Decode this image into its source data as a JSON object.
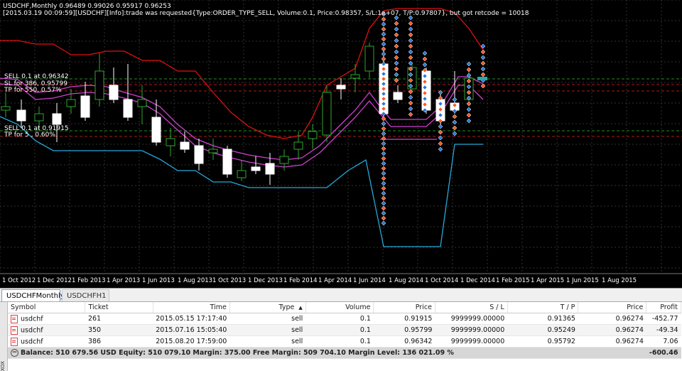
{
  "chart": {
    "title": "USDCHF,Monthly  0.96489 0.99026 0.95917 0.96253",
    "log_line": "[2015.03.19 00:09:59][USDCHF][Info]:trade was requested{Type:ORDER_TYPE_SELL, Volume:0.1, Price:0.98357, S/L:1e+07, T/P:0.97807}, but got retcode = 10018",
    "labels": {
      "sell1": "SELL 0.1 at 0.96342",
      "sl1": "SL for 386, 0.95799",
      "tp1": "TP for 550, 0.57%",
      "sell2": "SELL 0.1 at 0.91915",
      "tp2": "TP for 5 , 0.60%"
    },
    "x_ticks": [
      "1 Oct 2012",
      "1 Dec 2012",
      "1 Feb 2013",
      "1 Apr 2013",
      "1 Jun 2013",
      "1 Aug 2013",
      "1 Oct 2013",
      "1 Dec 2013",
      "1 Feb 2014",
      "1 Apr 2014",
      "1 Jun 2014",
      "1 Aug 2014",
      "1 Oct 2014",
      "1 Dec 2014",
      "1 Feb 2015",
      "1 Apr 2015",
      "1 Jun 2015",
      "1 Aug 2015"
    ],
    "colors": {
      "background": "#000000",
      "grid": "#303030",
      "bull": "#2ea62e",
      "bear": "#ffffff",
      "upper_band": "#e01010",
      "lower_band": "#27a8d8",
      "envelope": "#d040d0",
      "sell_arrow": "#ff5a2a",
      "buy_arrow": "#2e7ad8"
    }
  },
  "tabs": [
    {
      "label": "USDCHFMonthly",
      "active": true
    },
    {
      "label": "USDCHFH1",
      "active": false
    }
  ],
  "terminal": {
    "side_label": "XOX",
    "columns": [
      "Symbol",
      "Ticket",
      "Time",
      "Type",
      "Volume",
      "Price",
      "S / L",
      "T / P",
      "Price",
      "Profit"
    ],
    "rows": [
      [
        "usdchf",
        "261",
        "2015.05.15 17:17:40",
        "sell",
        "0.1",
        "0.91915",
        "9999999.00000",
        "0.91365",
        "0.96274",
        "-452.77"
      ],
      [
        "usdchf",
        "350",
        "2015.07.16 15:05:40",
        "sell",
        "0.1",
        "0.95799",
        "9999999.00000",
        "0.95249",
        "0.96274",
        "-49.34"
      ],
      [
        "usdchf",
        "386",
        "2015.08.20 17:59:00",
        "sell",
        "0.1",
        "0.96342",
        "9999999.00000",
        "0.95792",
        "0.96274",
        "7.06"
      ]
    ],
    "balance_line": "Balance: 510 679.56 USD  Equity: 510 079.10  Margin: 375.00  Free Margin: 509 704.10  Margin Level: 136 021.09 %",
    "total_profit": "-600.46"
  }
}
